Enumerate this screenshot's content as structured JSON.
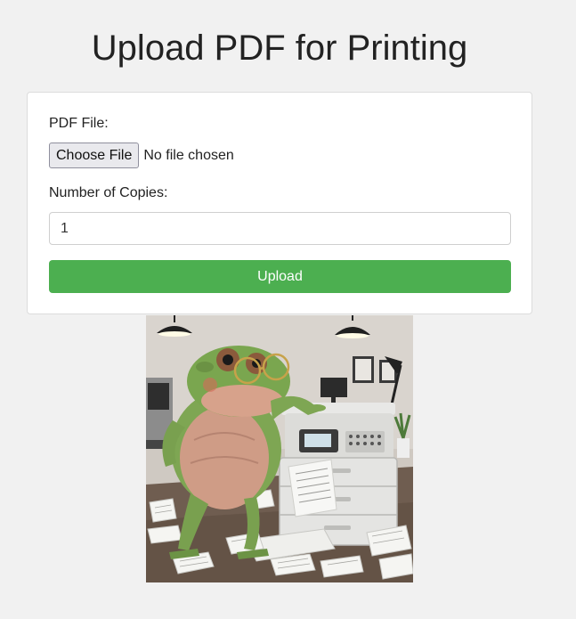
{
  "page": {
    "title": "Upload PDF for Printing"
  },
  "form": {
    "pdf_label": "PDF File:",
    "choose_file_label": "Choose File",
    "file_status": "No file chosen",
    "copies_label": "Number of Copies:",
    "copies_value": "1",
    "upload_label": "Upload"
  },
  "illustration": {
    "subject": "frog-with-glasses-using-photocopier"
  },
  "colors": {
    "background": "#f1f1f1",
    "card": "#ffffff",
    "upload_button": "#4caf50"
  }
}
